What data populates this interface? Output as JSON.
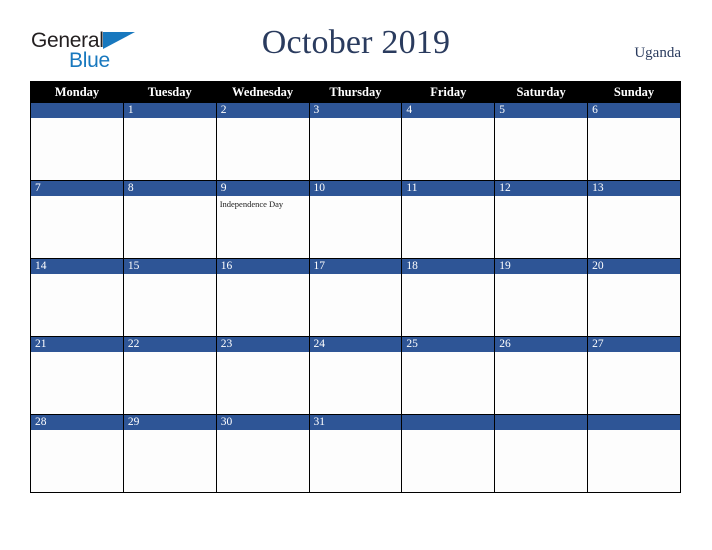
{
  "brand": {
    "name_part1": "General",
    "name_part2": "Blue",
    "triangle_icon": "triangle-icon",
    "color_dark": "#231f20",
    "color_blue": "#1878be"
  },
  "header": {
    "title": "October 2019",
    "country": "Uganda",
    "title_color": "#2a3b5e"
  },
  "calendar": {
    "weekday_headers": [
      "Monday",
      "Tuesday",
      "Wednesday",
      "Thursday",
      "Friday",
      "Saturday",
      "Sunday"
    ],
    "header_bg": "#000000",
    "header_text": "#ffffff",
    "daynum_bg": "#2e5596",
    "daynum_text": "#ffffff",
    "cell_bg": "#fdfdfd",
    "weeks": [
      [
        {
          "day": "",
          "event": ""
        },
        {
          "day": "1",
          "event": ""
        },
        {
          "day": "2",
          "event": ""
        },
        {
          "day": "3",
          "event": ""
        },
        {
          "day": "4",
          "event": ""
        },
        {
          "day": "5",
          "event": ""
        },
        {
          "day": "6",
          "event": ""
        }
      ],
      [
        {
          "day": "7",
          "event": ""
        },
        {
          "day": "8",
          "event": ""
        },
        {
          "day": "9",
          "event": "Independence Day"
        },
        {
          "day": "10",
          "event": ""
        },
        {
          "day": "11",
          "event": ""
        },
        {
          "day": "12",
          "event": ""
        },
        {
          "day": "13",
          "event": ""
        }
      ],
      [
        {
          "day": "14",
          "event": ""
        },
        {
          "day": "15",
          "event": ""
        },
        {
          "day": "16",
          "event": ""
        },
        {
          "day": "17",
          "event": ""
        },
        {
          "day": "18",
          "event": ""
        },
        {
          "day": "19",
          "event": ""
        },
        {
          "day": "20",
          "event": ""
        }
      ],
      [
        {
          "day": "21",
          "event": ""
        },
        {
          "day": "22",
          "event": ""
        },
        {
          "day": "23",
          "event": ""
        },
        {
          "day": "24",
          "event": ""
        },
        {
          "day": "25",
          "event": ""
        },
        {
          "day": "26",
          "event": ""
        },
        {
          "day": "27",
          "event": ""
        }
      ],
      [
        {
          "day": "28",
          "event": ""
        },
        {
          "day": "29",
          "event": ""
        },
        {
          "day": "30",
          "event": ""
        },
        {
          "day": "31",
          "event": ""
        },
        {
          "day": "",
          "event": ""
        },
        {
          "day": "",
          "event": ""
        },
        {
          "day": "",
          "event": ""
        }
      ]
    ]
  }
}
